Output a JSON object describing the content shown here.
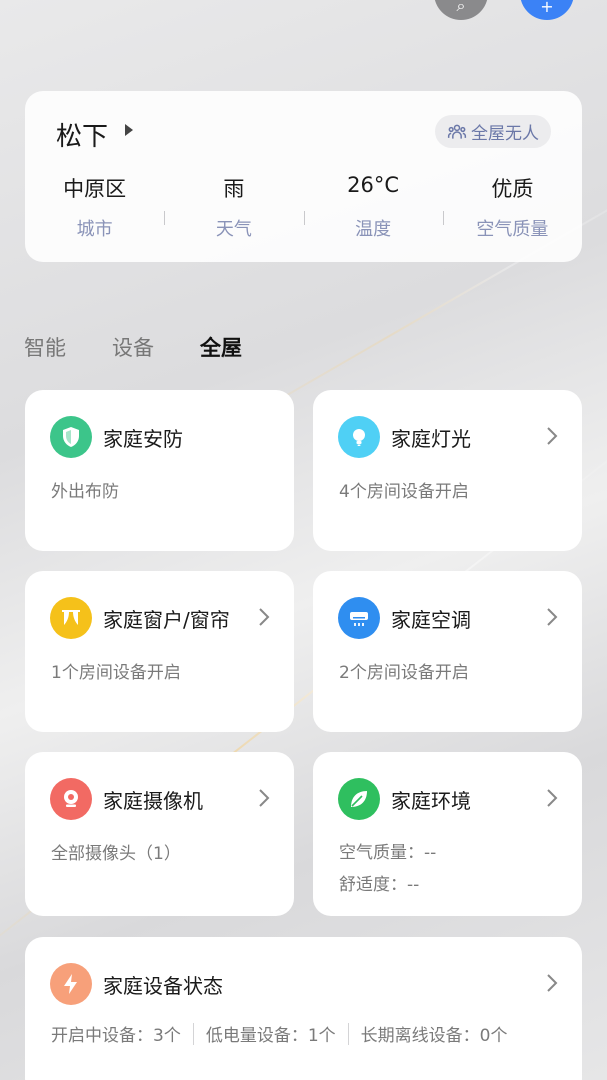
{
  "home": {
    "name": "松下",
    "presence": "全屋无人",
    "stats": [
      {
        "value": "中原区",
        "label": "城市"
      },
      {
        "value": "雨",
        "label": "天气"
      },
      {
        "value": "26°C",
        "label": "温度"
      },
      {
        "value": "优质",
        "label": "空气质量"
      }
    ]
  },
  "tabs": [
    {
      "label": "智能"
    },
    {
      "label": "设备"
    },
    {
      "label": "全屋"
    }
  ],
  "cards": {
    "security": {
      "title": "家庭安防",
      "sub": "外出布防",
      "icon": "shield-icon",
      "color": "#3cc58a"
    },
    "lighting": {
      "title": "家庭灯光",
      "sub": "4个房间设备开启",
      "icon": "bulb-icon",
      "color": "#4fd0f5"
    },
    "windows": {
      "title": "家庭窗户/窗帘",
      "sub": "1个房间设备开启",
      "icon": "curtain-icon",
      "color": "#f5c11a"
    },
    "ac": {
      "title": "家庭空调",
      "sub": "2个房间设备开启",
      "icon": "ac-icon",
      "color": "#2f8ef0"
    },
    "camera": {
      "title": "家庭摄像机",
      "sub": "全部摄像头（1）",
      "icon": "camera-icon",
      "color": "#f26a63"
    },
    "environment": {
      "title": "家庭环境",
      "sub1": "空气质量：--",
      "sub2": "舒适度：--",
      "icon": "leaf-icon",
      "color": "#2fbf5f"
    },
    "device_status": {
      "title": "家庭设备状态",
      "icon": "bolt-icon",
      "color": "#f7a07a",
      "on": "开启中设备：3个",
      "low_battery": "低电量设备：1个",
      "offline": "长期离线设备：0个"
    }
  }
}
